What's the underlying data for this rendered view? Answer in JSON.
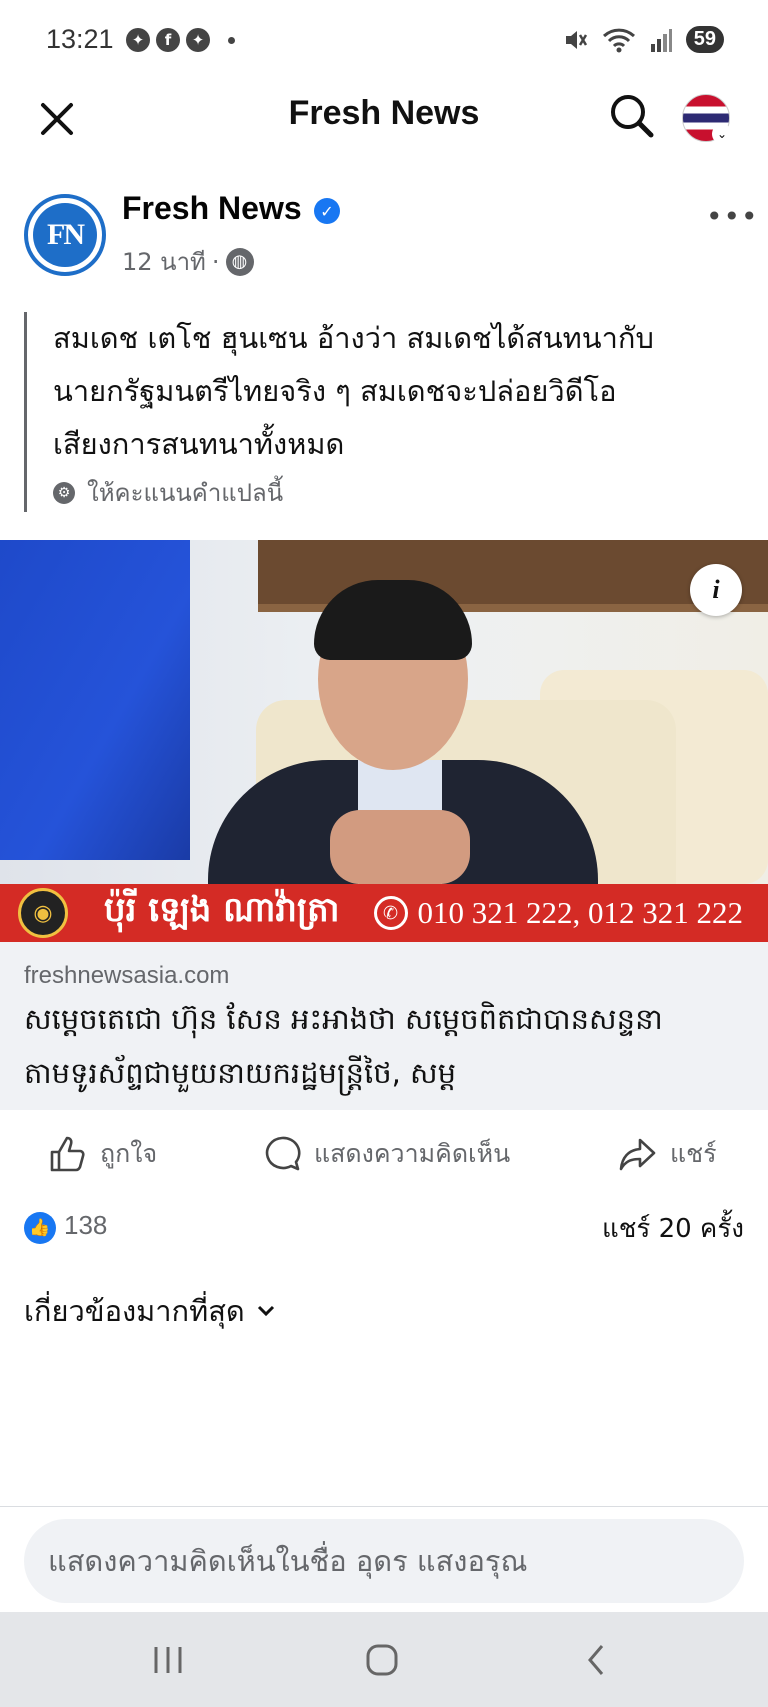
{
  "status_bar": {
    "time": "13:21",
    "battery": "59",
    "notification_icons": [
      "messenger-icon",
      "facebook-icon",
      "messenger-icon"
    ],
    "right_icons": [
      "mute-icon",
      "wifi-icon",
      "signal-icon"
    ]
  },
  "header": {
    "title": "Fresh News"
  },
  "post": {
    "page_name": "Fresh News",
    "page_logo_text": "FN",
    "verified": true,
    "time_ago": "12 นาที",
    "separator": "·",
    "text_lines": [
      "สมเดช เตโช ฮุนเซน อ้างว่า สมเดชได้สนทนากับ",
      "นายกรัฐมนตรีไทยจริง ๆ สมเดชจะปล่อยวิดีโอ",
      "เสียงการสนทนาทั้งหมด"
    ],
    "translate_label": "ให้คะแนนคำแปลนี้",
    "banner": {
      "name": "ប៉ុរី ឡេង ណាវ៉ាត្រា",
      "phone": "010 321 222, 012 321 222"
    },
    "link": {
      "domain": "freshnewsasia.com",
      "title_lines": [
        "សម្ដេចតេជោ ហ៊ុន សែន អះអាងថា សម្ដេចពិតជាបានសន្ទនា",
        "តាមទូរស័ព្ទជាមួយនាយករដ្ឋមន្ត្រីថៃ, សម្ដ"
      ]
    },
    "actions": {
      "like": "ถูกใจ",
      "comment": "แสดงความคิดเห็น",
      "share": "แชร์"
    },
    "stats": {
      "likes": "138",
      "shares": "แชร์ 20 ครั้ง"
    },
    "sort_label": "เกี่ยวข้องมากที่สุด"
  },
  "composer": {
    "placeholder": "แสดงความคิดเห็นในชื่อ อุดร แสงอรุณ"
  },
  "colors": {
    "brand_blue": "#1877f2",
    "banner_red": "#d42b25",
    "muted_text": "#65676b"
  }
}
